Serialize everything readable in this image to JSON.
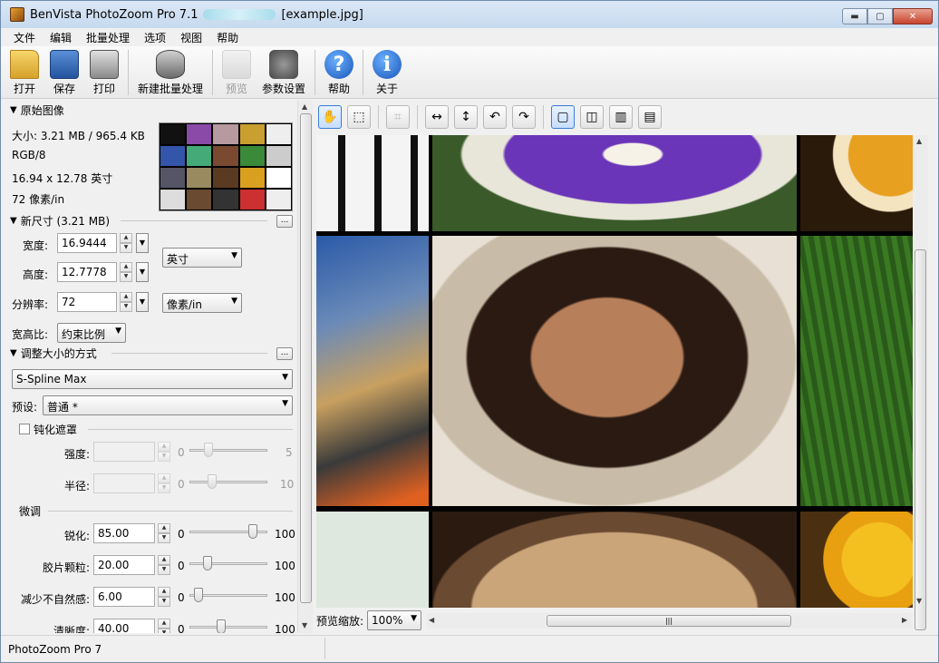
{
  "window": {
    "title_prefix": "BenVista PhotoZoom Pro 7.1",
    "title_suffix": "[example.jpg]",
    "minimize_glyph": "▬",
    "maximize_glyph": "▢",
    "close_glyph": "✕"
  },
  "menu": [
    "文件",
    "编辑",
    "批量处理",
    "选项",
    "视图",
    "帮助"
  ],
  "toolbar": {
    "open": "打开",
    "save": "保存",
    "print": "打印",
    "new_batch": "新建批量处理",
    "preview": "预览",
    "settings": "参数设置",
    "help": "帮助",
    "about": "关于"
  },
  "original": {
    "header": "原始图像",
    "size": "大小: 3.21 MB / 965.4 KB",
    "color": "RGB/8",
    "dimensions": "16.94 x 12.78 英寸",
    "resolution": "72 像素/in"
  },
  "new_size": {
    "header": "新尺寸 (3.21 MB)",
    "more": "...",
    "width_label": "宽度:",
    "width_value": "16.9444",
    "height_label": "高度:",
    "height_value": "12.7778",
    "res_label": "分辨率:",
    "res_value": "72",
    "unit": "英寸",
    "res_unit": "像素/in",
    "aspect_label": "宽高比:",
    "aspect_value": "约束比例"
  },
  "resize": {
    "header": "调整大小的方式",
    "more": "...",
    "method": "S-Spline Max",
    "preset_label": "预设:",
    "preset_value": "普通 *"
  },
  "unsharp": {
    "header": "钝化遮罩",
    "strength_label": "强度:",
    "strength_min": "0",
    "strength_max": "5",
    "radius_label": "半径:",
    "radius_min": "0",
    "radius_max": "10"
  },
  "fine_tune": {
    "header": "微调",
    "sharp_label": "锐化:",
    "sharp_value": "85.00",
    "sharp_min": "0",
    "sharp_max": "100",
    "sharp_level": 0.85,
    "grain_label": "胶片颗粒:",
    "grain_value": "20.00",
    "grain_min": "0",
    "grain_max": "100",
    "grain_level": 0.2,
    "artifact_label": "减少不自然感:",
    "artifact_value": "6.00",
    "artifact_min": "0",
    "artifact_max": "100",
    "artifact_level": 0.06,
    "clarity_label": "清晰度:",
    "clarity_value": "40.00",
    "clarity_min": "0",
    "clarity_max": "100",
    "clarity_level": 0.4
  },
  "preview": {
    "zoom_label": "预览缩放:",
    "zoom_value": "100%"
  },
  "status": {
    "text": "PhotoZoom Pro 7"
  },
  "colors": {
    "accent": "#3a7bd5",
    "title_bar": "#c6d9ef"
  }
}
